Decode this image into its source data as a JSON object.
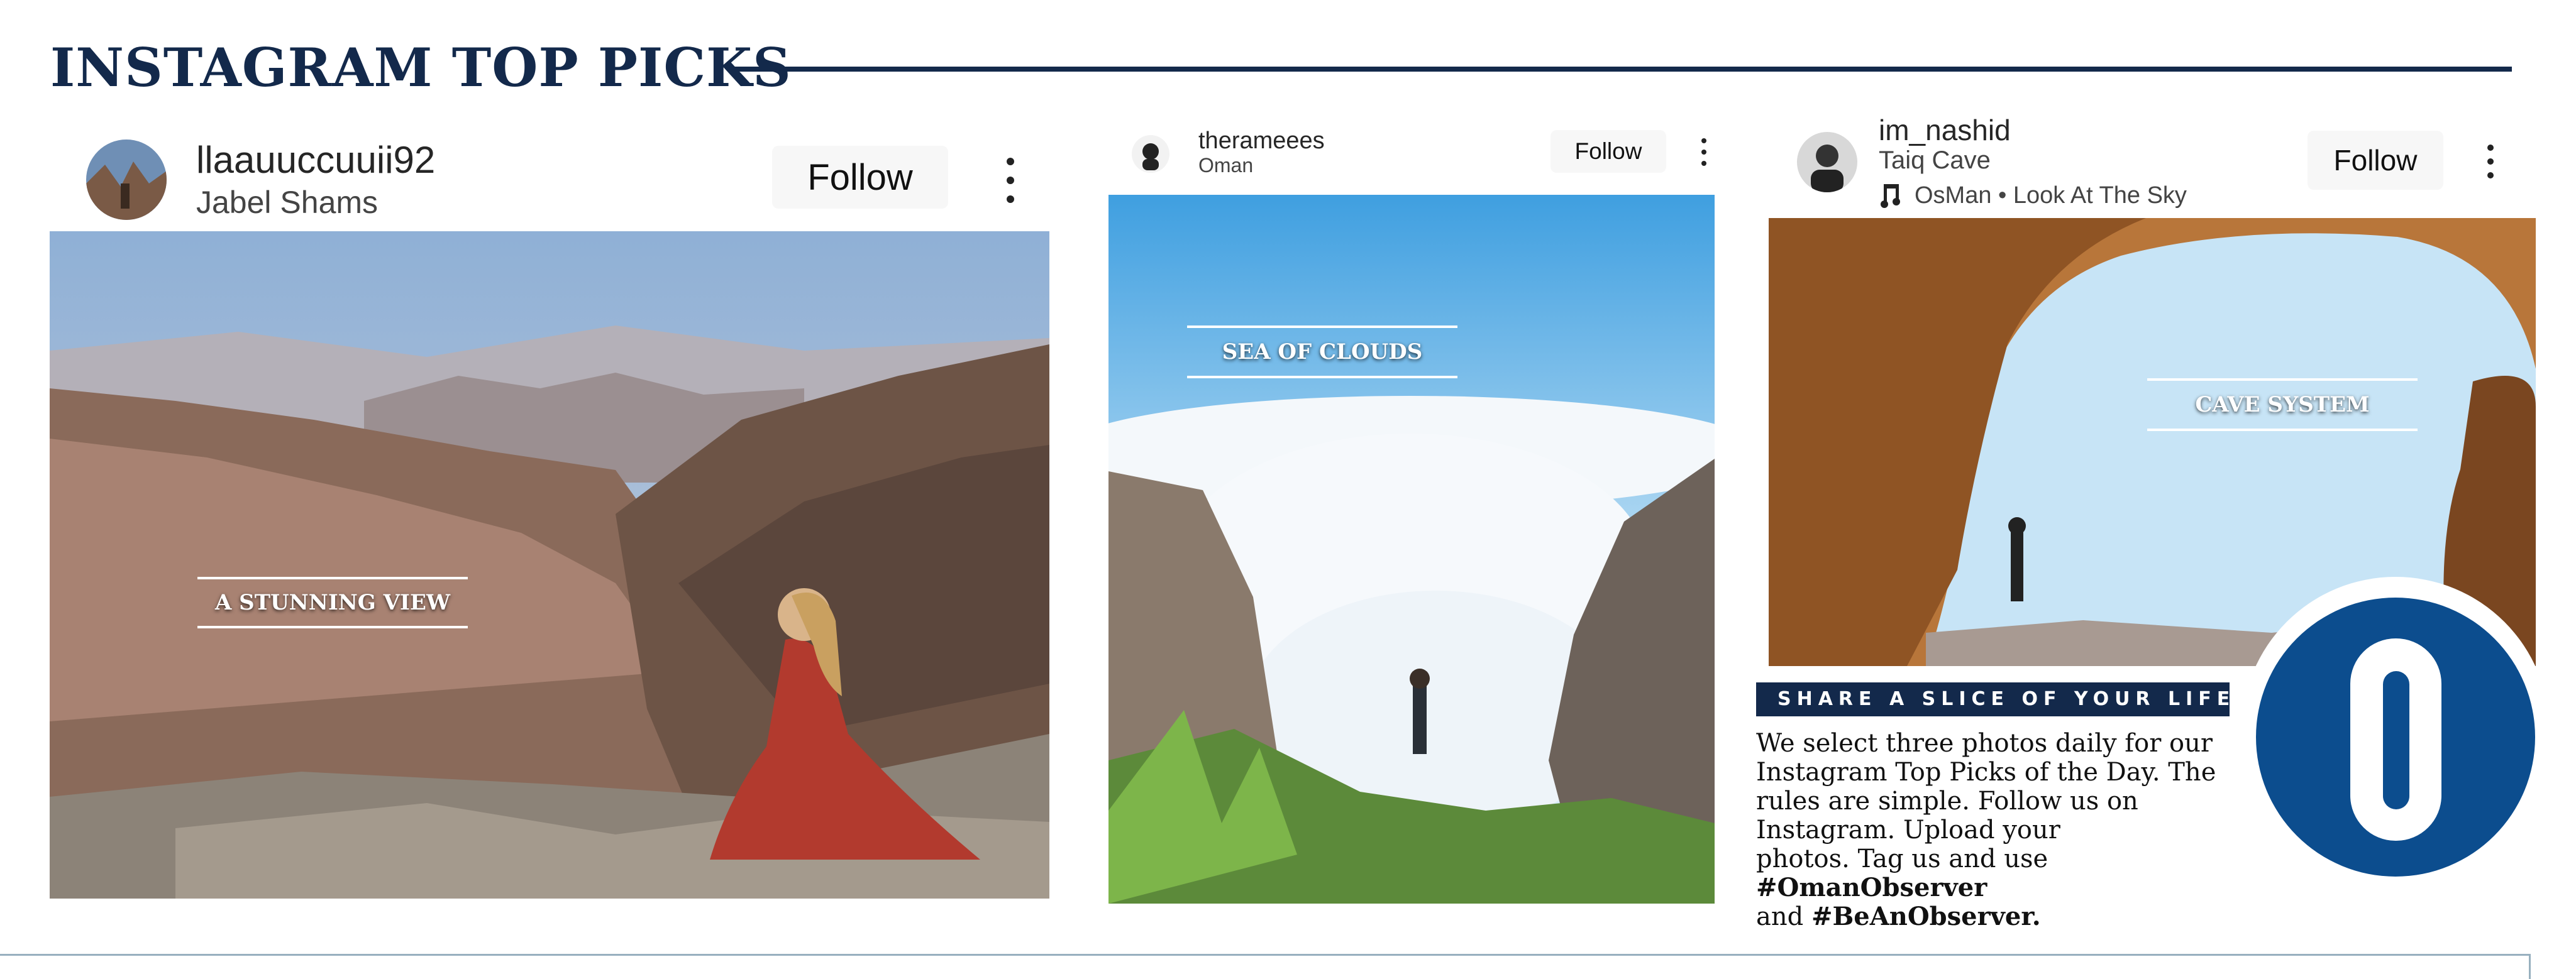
{
  "page": {
    "title": "INSTAGRAM TOP PICKS"
  },
  "colors": {
    "navy": "#13294b",
    "logo_blue": "#0c4d8e"
  },
  "posts": [
    {
      "username": "llaauuccuuii92",
      "location": "Jabel Shams",
      "follow_label": "Follow",
      "caption": "A STUNNING VIEW"
    },
    {
      "username": "therameees",
      "location": "Oman",
      "follow_label": "Follow",
      "caption": "SEA OF CLOUDS"
    },
    {
      "username": "im_nashid",
      "location": "Taiq Cave",
      "music": "OsMan • Look At The Sky",
      "follow_label": "Follow",
      "caption": "CAVE SYSTEM"
    }
  ],
  "info": {
    "heading": "SHARE A SLICE OF YOUR LIFE",
    "body_lines": [
      "We select three photos daily for our",
      "Instagram Top Picks of the Day. The",
      "rules are simple. Follow us on",
      "Instagram. Upload your"
    ],
    "line5_text": "photos. Tag us and use",
    "hashtag1": "#OmanObserver",
    "line6_and": "and",
    "hashtag2": "#BeAnObserver."
  },
  "logo": {
    "letter": "O"
  },
  "icons": [
    "more-vertical-icon",
    "music-note-icon",
    "avatar"
  ]
}
